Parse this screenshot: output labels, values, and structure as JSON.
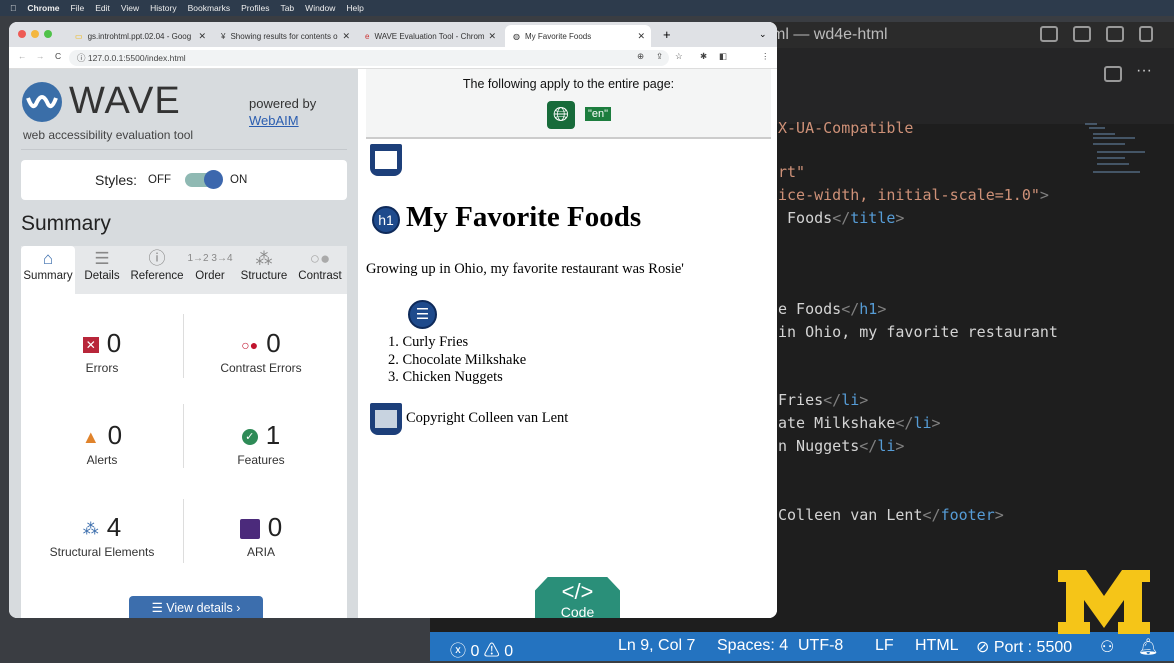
{
  "menubar": {
    "app": "Chrome",
    "items": [
      "File",
      "Edit",
      "View",
      "History",
      "Bookmarks",
      "Profiles",
      "Tab",
      "Window",
      "Help"
    ]
  },
  "browser": {
    "tabs": [
      {
        "title": "gs.introhtml.ppt.02.04 - Goog",
        "icon": "slides-icon"
      },
      {
        "title": "Showing results for contents o",
        "icon": "search-results-icon"
      },
      {
        "title": "WAVE Evaluation Tool - Chrom",
        "icon": "wave-icon"
      },
      {
        "title": "My Favorite Foods",
        "icon": "globe-icon",
        "active": true
      }
    ],
    "url": "127.0.0.1:5500/index.html"
  },
  "wave": {
    "title": "WAVE",
    "subtitle": "web accessibility evaluation tool",
    "powered_by": "powered by",
    "webaim": "WebAIM",
    "styles_label": "Styles:",
    "off": "OFF",
    "on": "ON",
    "styles_on": true,
    "summary_heading": "Summary",
    "tabs": [
      {
        "label": "Summary",
        "icon": "home-icon"
      },
      {
        "label": "Details",
        "icon": "list-icon"
      },
      {
        "label": "Reference",
        "icon": "info-icon"
      },
      {
        "label": "Order",
        "icon": "order-icon"
      },
      {
        "label": "Structure",
        "icon": "structure-icon"
      },
      {
        "label": "Contrast",
        "icon": "contrast-icon"
      }
    ],
    "stats": [
      {
        "label": "Errors",
        "value": "0",
        "color": "#b8263a"
      },
      {
        "label": "Contrast Errors",
        "value": "0",
        "color": "#c0142e"
      },
      {
        "label": "Alerts",
        "value": "0",
        "color": "#e0832b"
      },
      {
        "label": "Features",
        "value": "1",
        "color": "#2e8b57"
      },
      {
        "label": "Structural Elements",
        "value": "4",
        "color": "#3c6ead"
      },
      {
        "label": "ARIA",
        "value": "0",
        "color": "#4b2a7b"
      }
    ],
    "view_details": "View details ›"
  },
  "page": {
    "apply_text": "The following apply to the entire page:",
    "lang": "\"en\"",
    "h1_badge": "h1",
    "heading": "My Favorite Foods",
    "paragraph": "Growing up in Ohio, my favorite restaurant was Rosie'",
    "list": [
      "1. Curly Fries",
      "2. Chocolate Milkshake",
      "3. Chicken Nuggets"
    ],
    "footer": "Copyright Colleen van Lent",
    "code_button": "Code",
    "code_symbol": "</>"
  },
  "vscode": {
    "title": "ml — wd4e-html",
    "code_lines": [
      {
        "parts": [
          [
            "s",
            "X-UA-Compatible"
          ]
        ]
      },
      {
        "parts": [
          [
            "s",
            "rt\""
          ]
        ]
      },
      {
        "parts": [
          [
            "s",
            "ice-width, initial-scale=1.0\""
          ],
          [
            "p",
            ">"
          ]
        ]
      },
      {
        "parts": [
          [
            "t",
            " Foods"
          ],
          [
            "p",
            "</"
          ],
          [
            "tag",
            "title"
          ],
          [
            "p",
            ">"
          ]
        ]
      },
      {
        "parts": [
          [
            "t",
            "e Foods"
          ],
          [
            "p",
            "</"
          ],
          [
            "tag",
            "h1"
          ],
          [
            "p",
            ">"
          ]
        ]
      },
      {
        "parts": [
          [
            "t",
            "in Ohio, my favorite restaurant"
          ]
        ]
      },
      {
        "parts": [
          [
            "t",
            "Fries"
          ],
          [
            "p",
            "</"
          ],
          [
            "tag",
            "li"
          ],
          [
            "p",
            ">"
          ]
        ]
      },
      {
        "parts": [
          [
            "t",
            "ate Milkshake"
          ],
          [
            "p",
            "</"
          ],
          [
            "tag",
            "li"
          ],
          [
            "p",
            ">"
          ]
        ]
      },
      {
        "parts": [
          [
            "t",
            "n Nuggets"
          ],
          [
            "p",
            "</"
          ],
          [
            "tag",
            "li"
          ],
          [
            "p",
            ">"
          ]
        ]
      },
      {
        "parts": [
          [
            "t",
            "Colleen van Lent"
          ],
          [
            "p",
            "</"
          ],
          [
            "tag",
            "footer"
          ],
          [
            "p",
            ">"
          ]
        ]
      }
    ],
    "status": {
      "errors": "0",
      "warnings": "0",
      "position": "Ln 9, Col 7",
      "spaces": "Spaces: 4",
      "encoding": "UTF-8",
      "eol": "LF",
      "language": "HTML",
      "port": "Port : 5500"
    }
  },
  "colors": {
    "wave_blue": "#3c6ead",
    "status_bar": "#2473c0",
    "michigan_maize": "#f5c518",
    "code_green": "#2a8f79"
  }
}
